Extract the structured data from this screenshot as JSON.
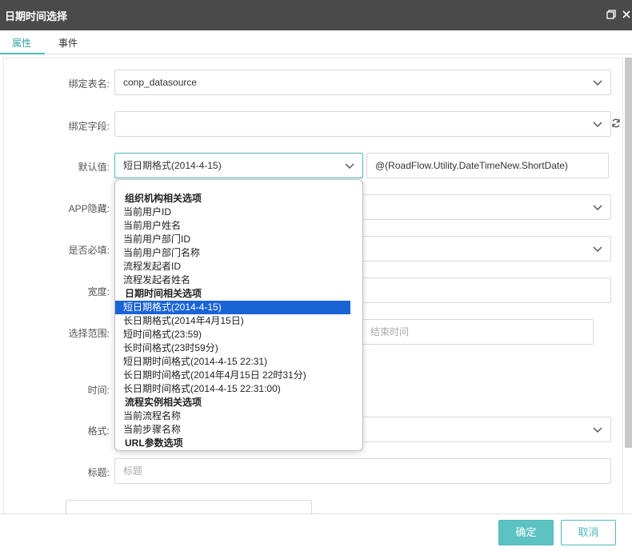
{
  "window": {
    "title": "日期时间选择",
    "restore_icon": "restore-icon",
    "close_icon": "close-icon"
  },
  "tabs": [
    {
      "label": "属性",
      "active": true
    },
    {
      "label": "事件",
      "active": false
    }
  ],
  "form": {
    "bind_table": {
      "label": "绑定表名:",
      "value": "conp_datasource"
    },
    "bind_field": {
      "label": "绑定字段:",
      "value": ""
    },
    "default_value": {
      "label": "默认值:",
      "value": "短日期格式(2014-4-15)",
      "expression": "@(RoadFlow.Utility.DateTimeNew.ShortDate)"
    },
    "app_hidden": {
      "label": "APP隐藏:"
    },
    "required": {
      "label": "是否必填:"
    },
    "width": {
      "label": "宽度:"
    },
    "range": {
      "label": "选择范围:",
      "end_placeholder": "结束时间"
    },
    "time": {
      "label": "时间:"
    },
    "format": {
      "label": "格式:"
    },
    "heading": {
      "label": "标题:",
      "placeholder": "标题"
    }
  },
  "dropdown": {
    "items": [
      {
        "text": "组织机构相关选项",
        "group": true
      },
      {
        "text": "当前用户ID"
      },
      {
        "text": "当前用户姓名"
      },
      {
        "text": "当前用户部门ID"
      },
      {
        "text": "当前用户部门名称"
      },
      {
        "text": "流程发起者ID"
      },
      {
        "text": "流程发起者姓名"
      },
      {
        "text": "日期时间相关选项",
        "group": true
      },
      {
        "text": "短日期格式(2014-4-15)",
        "selected": true
      },
      {
        "text": "长日期格式(2014年4月15日)"
      },
      {
        "text": "短时间格式(23:59)"
      },
      {
        "text": "长时间格式(23时59分)"
      },
      {
        "text": "短日期时间格式(2014-4-15 22:31)"
      },
      {
        "text": "长日期时间格式(2014年4月15日 22时31分)"
      },
      {
        "text": "长日期时间格式(2014-4-15 22:31:00)"
      },
      {
        "text": "流程实例相关选项",
        "group": true
      },
      {
        "text": "当前流程名称"
      },
      {
        "text": "当前步骤名称"
      },
      {
        "text": "URL参数选项",
        "group": true
      }
    ]
  },
  "footer": {
    "confirm_label": "确定",
    "cancel_label": "取消"
  },
  "colors": {
    "accent": "#4fb8b8",
    "titlebar": "#4a4a4a",
    "selected": "#1a63d6"
  }
}
